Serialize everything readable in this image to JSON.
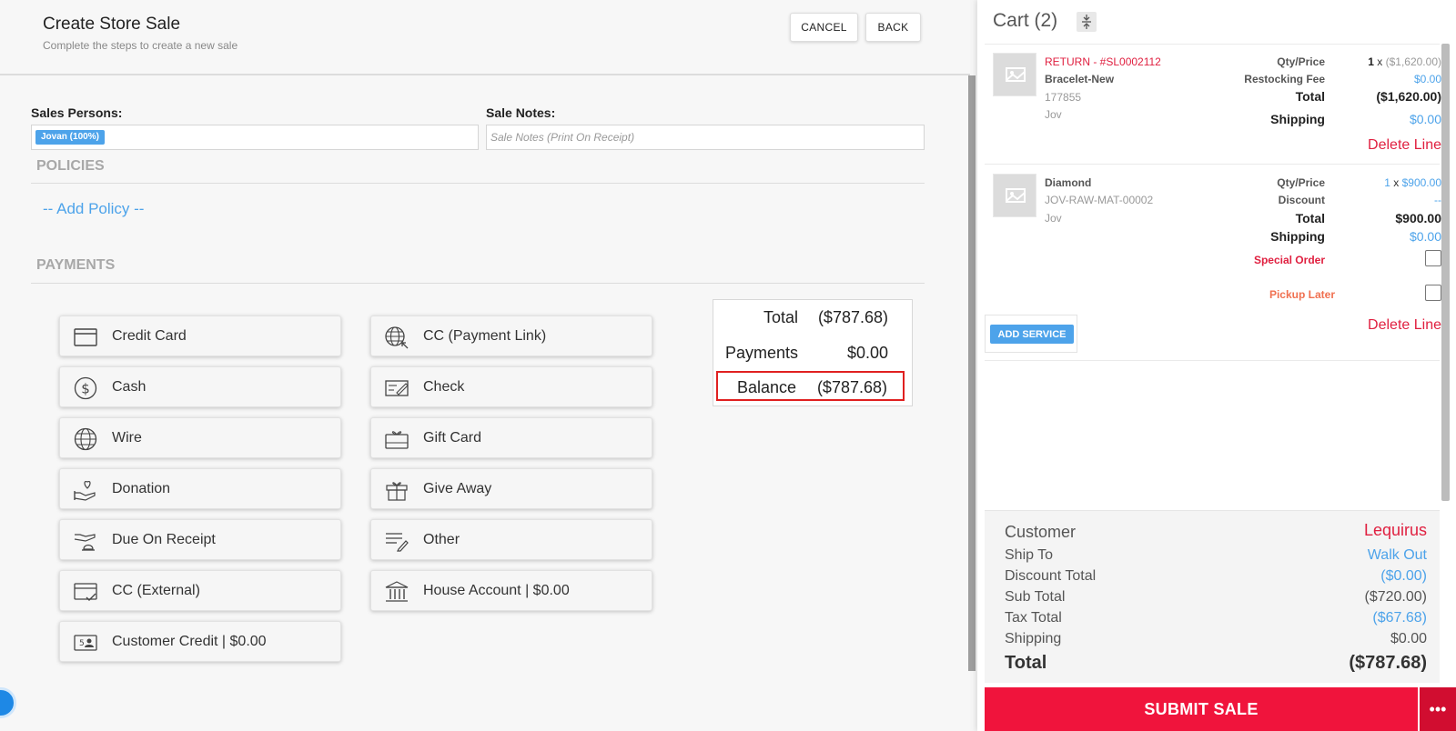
{
  "header": {
    "title": "Create Store Sale",
    "subtitle": "Complete the steps to create a new sale",
    "cancel_label": "CANCEL",
    "back_label": "BACK"
  },
  "form": {
    "sales_persons_label": "Sales Persons:",
    "sales_person_chip": "Jovan (100%)",
    "sale_notes_label": "Sale Notes:",
    "sale_notes_placeholder": "Sale Notes (Print On Receipt)"
  },
  "policies": {
    "title": "POLICIES",
    "add_label": "-- Add Policy --"
  },
  "payments": {
    "title": "PAYMENTS",
    "methods": [
      {
        "label": "Credit Card",
        "icon": "credit-card-icon"
      },
      {
        "label": "CC (Payment Link)",
        "icon": "globe-link-icon"
      },
      {
        "label": "Cash",
        "icon": "dollar-circle-icon"
      },
      {
        "label": "Check",
        "icon": "check-icon"
      },
      {
        "label": "Wire",
        "icon": "globe-icon"
      },
      {
        "label": "Gift Card",
        "icon": "gift-card-icon"
      },
      {
        "label": "Donation",
        "icon": "heart-hand-icon"
      },
      {
        "label": "Give Away",
        "icon": "gift-box-icon"
      },
      {
        "label": "Due On Receipt",
        "icon": "bell-hand-icon"
      },
      {
        "label": "Other",
        "icon": "list-pencil-icon"
      },
      {
        "label": "CC (External)",
        "icon": "card-check-icon"
      },
      {
        "label": "House Account | $0.00",
        "icon": "bank-icon"
      },
      {
        "label": "Customer Credit | $0.00",
        "icon": "id-card-icon"
      }
    ]
  },
  "totals": {
    "total_label": "Total",
    "total_value": "($787.68)",
    "payments_label": "Payments",
    "payments_value": "$0.00",
    "balance_label": "Balance",
    "balance_value": "($787.68)"
  },
  "cart": {
    "title": "Cart (2)",
    "items": [
      {
        "tag": "RETURN - #SL0002112",
        "name": "Bracelet-New",
        "sku": "177855",
        "owner": "Jov",
        "qty_price_label": "Qty/Price",
        "qty": "1",
        "qty_x": "x",
        "price": "($1,620.00)",
        "fee_label": "Restocking Fee",
        "fee_value": "$0.00",
        "total_label": "Total",
        "total_value": "($1,620.00)",
        "shipping_label": "Shipping",
        "shipping_value": "$0.00",
        "delete_label": "Delete Line"
      },
      {
        "name": "Diamond",
        "sku": "JOV-RAW-MAT-00002",
        "owner": "Jov",
        "qty_price_label": "Qty/Price",
        "qty": "1",
        "qty_x": "x",
        "price": "$900.00",
        "discount_label": "Discount",
        "discount_value": "--",
        "total_label": "Total",
        "total_value": "$900.00",
        "shipping_label": "Shipping",
        "shipping_value": "$0.00",
        "special_order_label": "Special Order",
        "pickup_later_label": "Pickup Later",
        "delete_label": "Delete Line"
      }
    ],
    "add_service_label": "ADD SERVICE",
    "summary": {
      "customer_label": "Customer",
      "customer_value": "Lequirus",
      "ship_to_label": "Ship To",
      "ship_to_value": "Walk Out",
      "discount_total_label": "Discount Total",
      "discount_total_value": "($0.00)",
      "sub_total_label": "Sub Total",
      "sub_total_value": "($720.00)",
      "tax_total_label": "Tax Total",
      "tax_total_value": "($67.68)",
      "shipping_label": "Shipping",
      "shipping_value": "$0.00",
      "total_label": "Total",
      "total_value": "($787.68)"
    },
    "submit_label": "SUBMIT SALE",
    "more_label": "•••"
  },
  "colors": {
    "accent_blue": "#4da3ea",
    "danger_red": "#e02040",
    "submit_red": "#f0143c"
  }
}
